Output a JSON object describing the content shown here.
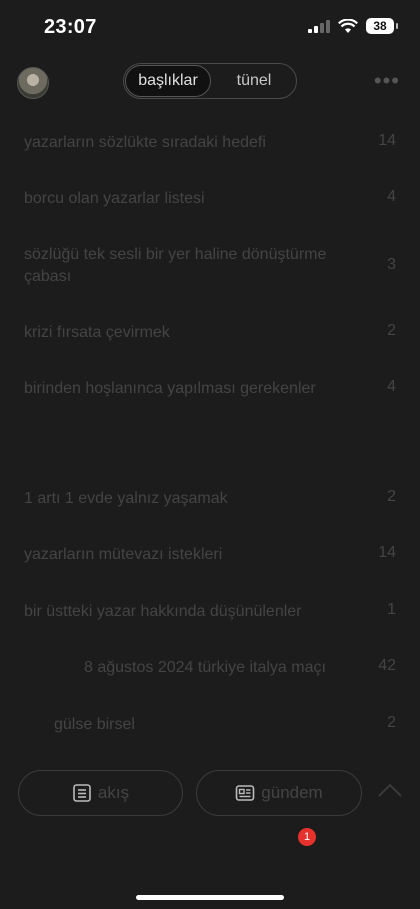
{
  "status": {
    "time": "23:07",
    "battery": "38"
  },
  "header": {
    "tabs": [
      {
        "label": "başlıklar",
        "active": true
      },
      {
        "label": "tünel",
        "active": false
      }
    ]
  },
  "topics": [
    {
      "title": "yazarların sözlükte sıradaki hedefi",
      "count": "14"
    },
    {
      "title": "borcu olan yazarlar listesi",
      "count": "4"
    },
    {
      "title": "sözlüğü tek sesli bir yer haline dönüştürme çabası",
      "count": "3"
    },
    {
      "title": "krizi fırsata çevirmek",
      "count": "2"
    },
    {
      "title": "birinden hoşlanınca yapılması gerekenler",
      "count": "4"
    },
    {
      "title": "1 artı 1 evde yalnız yaşamak",
      "count": "2"
    },
    {
      "title": "yazarların mütevazı istekleri",
      "count": "14"
    },
    {
      "title": "bir üstteki yazar hakkında düşünülenler",
      "count": "1"
    },
    {
      "title": "8 ağustos 2024 türkiye italya maçı",
      "count": "42"
    },
    {
      "title": "gülse birsel",
      "count": "2"
    }
  ],
  "bottom_nav": {
    "feed_label": "akış",
    "agenda_label": "gündem",
    "notification_count": "1"
  }
}
